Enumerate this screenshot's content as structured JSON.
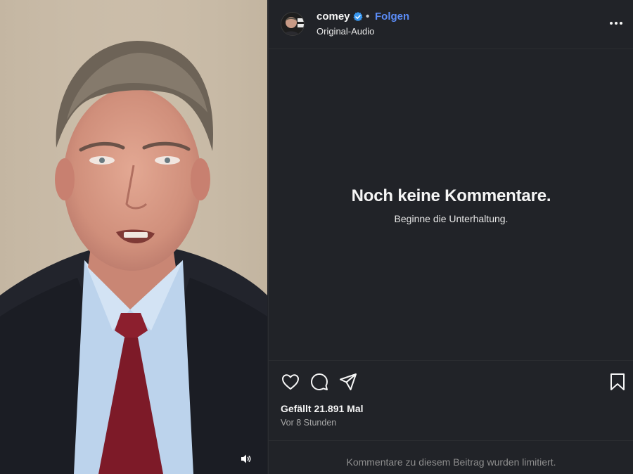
{
  "post": {
    "username": "comey",
    "follow_label": "Folgen",
    "separator": "•",
    "audio_label": "Original-Audio"
  },
  "comments": {
    "empty_title": "Noch keine Kommentare.",
    "empty_subtitle": "Beginne die Unterhaltung."
  },
  "stats": {
    "likes": "Gefällt 21.891 Mal",
    "timestamp": "Vor 8 Stunden"
  },
  "footer": {
    "limited_text": "Kommentare zu diesem Beitrag wurden limitiert."
  },
  "icons": {
    "verified": "verified-badge-icon",
    "more": "more-options-icon",
    "like": "heart-icon",
    "comment": "comment-icon",
    "share": "paper-plane-icon",
    "save": "bookmark-icon",
    "mute": "speaker-icon"
  },
  "colors": {
    "background": "#212328",
    "accent": "#5b8cf7",
    "verified": "#3897f0",
    "muted_text": "#8e8e8e"
  }
}
